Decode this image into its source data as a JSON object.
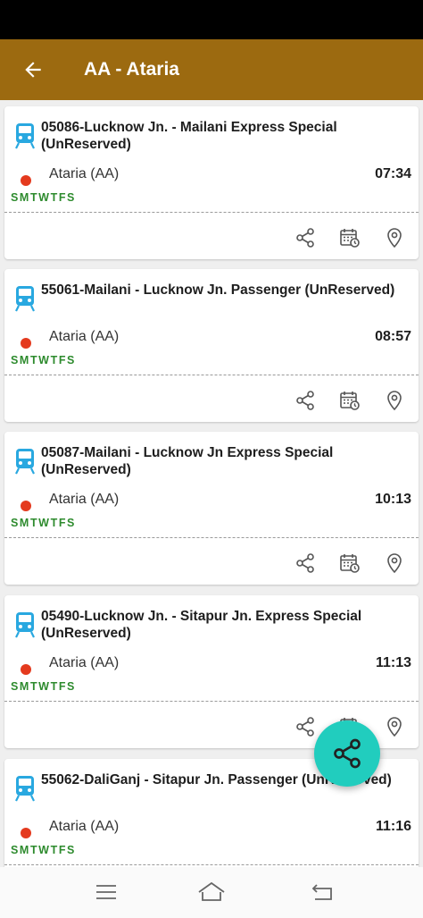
{
  "header": {
    "title": "AA - Ataria"
  },
  "trains": [
    {
      "name": "05086-Lucknow Jn. - Mailani Express Special (UnReserved)",
      "station": "Ataria (AA)",
      "time": "07:34",
      "days": "SMTWTFS"
    },
    {
      "name": "55061-Mailani - Lucknow Jn. Passenger (UnReserved)",
      "station": "Ataria (AA)",
      "time": "08:57",
      "days": "SMTWTFS"
    },
    {
      "name": "05087-Mailani - Lucknow Jn Express Special (UnReserved)",
      "station": "Ataria (AA)",
      "time": "10:13",
      "days": "SMTWTFS"
    },
    {
      "name": "05490-Lucknow Jn. - Sitapur Jn. Express Special (UnReserved)",
      "station": "Ataria (AA)",
      "time": "11:13",
      "days": "SMTWTFS"
    },
    {
      "name": "55062-DaliGanj - Sitapur Jn. Passenger (UnReserved)",
      "station": "Ataria (AA)",
      "time": "11:16",
      "days": "SMTWTFS"
    }
  ],
  "icons": {
    "back": "arrow-left-icon",
    "train": "train-icon",
    "share": "share-icon",
    "schedule": "calendar-clock-icon",
    "location": "map-pin-icon",
    "fab": "share-icon",
    "nav": [
      "menu-icon",
      "home-icon",
      "back-icon"
    ]
  },
  "colors": {
    "app_bar": "#9c6a10",
    "train_icon": "#29a8e0",
    "station_dot": "#e43a1e",
    "days_text": "#2e8b2e",
    "fab": "#21cdbe"
  }
}
